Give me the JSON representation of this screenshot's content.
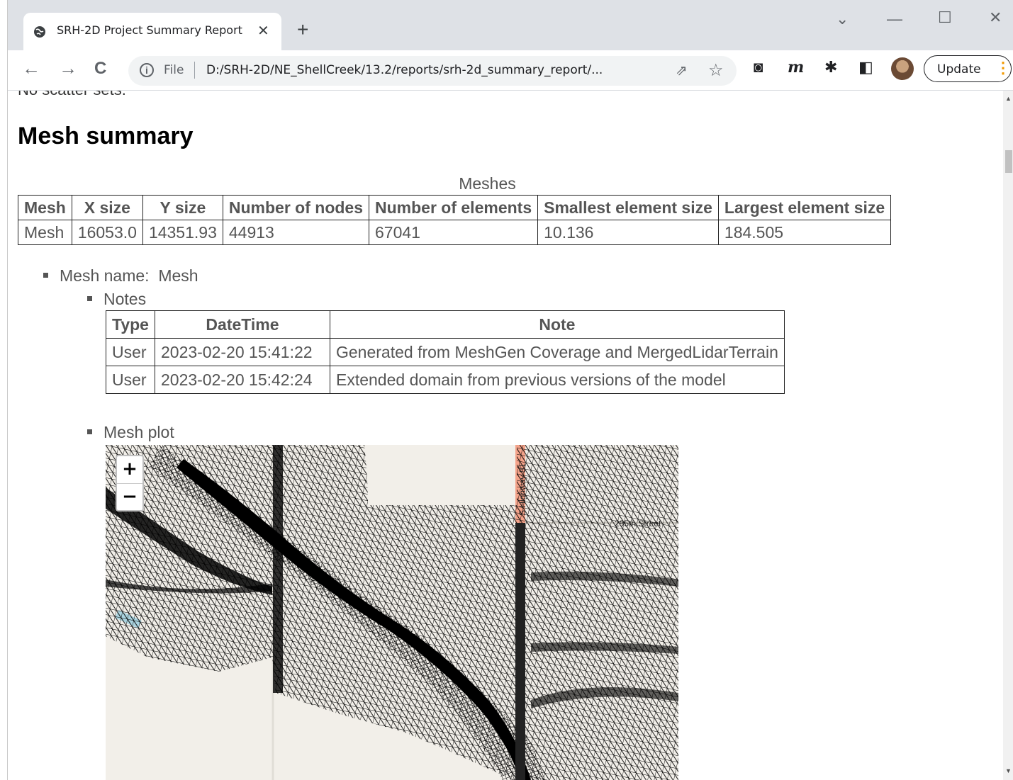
{
  "browser": {
    "tab_title": "SRH-2D Project Summary Report",
    "tab_close": "✕",
    "new_tab": "+",
    "file_label": "File",
    "url": "D:/SRH-2D/NE_ShellCreek/13.2/reports/srh-2d_summary_report/...",
    "update_label": "Update",
    "window_controls": {
      "minimize": "—",
      "maximize": "☐",
      "close": "✕",
      "dropdown": "⌄"
    },
    "nav": {
      "back": "←",
      "forward": "→",
      "reload": "C"
    }
  },
  "page": {
    "cutoff_text": "No scatter sets.",
    "heading": "Mesh summary",
    "mesh_table": {
      "caption": "Meshes",
      "headers": [
        "Mesh",
        "X size",
        "Y size",
        "Number of nodes",
        "Number of elements",
        "Smallest element size",
        "Largest element size"
      ],
      "rows": [
        [
          "Mesh",
          "16053.0",
          "14351.93",
          "44913",
          "67041",
          "10.136",
          "184.505"
        ]
      ]
    },
    "mesh_name_label": "Mesh name:",
    "mesh_name_value": "Mesh",
    "notes_label": "Notes",
    "notes_table": {
      "headers": [
        "Type",
        "DateTime",
        "Note"
      ],
      "rows": [
        [
          "User",
          "2023-02-20 15:41:22",
          "Generated from MeshGen Coverage and MergedLidarTerrain"
        ],
        [
          "User",
          "2023-02-20 15:42:24",
          "Extended domain from previous versions of the model"
        ]
      ]
    },
    "mesh_plot_label": "Mesh plot",
    "map": {
      "zoom_in": "+",
      "zoom_out": "−",
      "road_label_vertical": "S Highway 81",
      "road_label_horizontal": "295th Street"
    }
  },
  "colors": {
    "tab_strip": "#dee1e6",
    "update_accent": "#f29900",
    "road": "#f4a38a"
  }
}
